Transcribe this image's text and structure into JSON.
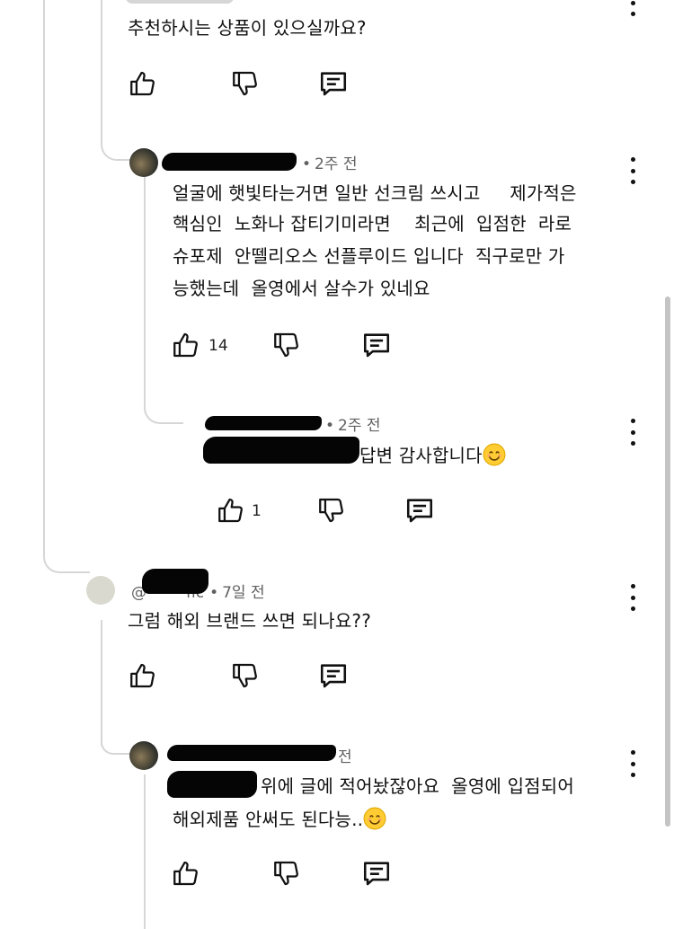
{
  "comments": [
    {
      "text": "추천하시는 상품이 있으실까요?",
      "likes": ""
    },
    {
      "time": "2주 전",
      "text_lines": [
        "얼굴에 햇빛타는거면 일반 선크림 쓰시고     제가적은",
        "핵심인  노화나 잡티기미라면    최근에  입점한  라로",
        "슈포제  안뗄리오스 선플루이드 입니다  직구로만 가",
        "능했는데  올영에서 살수가 있네요"
      ],
      "likes": "14"
    },
    {
      "time": "2주 전",
      "text": "답변 감사합니다",
      "likes": "1"
    },
    {
      "handle_prefix": "@",
      "handle_fragment": "flc",
      "time": "7일 전",
      "text": "그럼 해외 브랜드 쓰면 되나요??",
      "likes": ""
    },
    {
      "time_fragment": "전",
      "text_lines": [
        "위에 글에 적어놨잖아요  올영에 입점되어",
        "해외제품 안써도 된다능.."
      ],
      "likes": ""
    }
  ],
  "icons": {
    "like": "thumbs-up-icon",
    "dislike": "thumbs-down-icon",
    "reply": "reply-comment-icon",
    "menu": "more-vert-icon",
    "emoji": "smiling-face-emoji"
  },
  "colors": {
    "text": "#111111",
    "meta": "#606060",
    "thread": "#d6d6d6",
    "redaction": "#050505"
  }
}
